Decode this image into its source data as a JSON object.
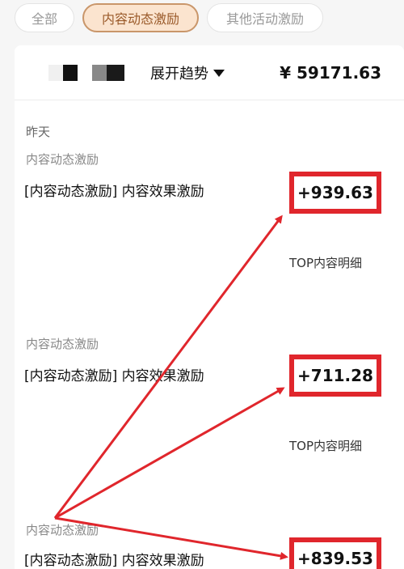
{
  "tabs": {
    "all": "全部",
    "content": "内容动态激励",
    "other": "其他活动激励"
  },
  "summary": {
    "expand_label": "展开趋势",
    "total": "¥ 59171.63"
  },
  "date_label": "昨天",
  "entries": [
    {
      "category": "内容动态激励",
      "description": "[内容动态激励] 内容效果激励",
      "amount": "+939.63",
      "detail_link": "TOP内容明细"
    },
    {
      "category": "内容动态激励",
      "description": "[内容动态激励] 内容效果激励",
      "amount": "+711.28",
      "detail_link": "TOP内容明细"
    },
    {
      "category": "内容动态激励",
      "description": "[内容动态激励] 内容效果激励",
      "amount": "+839.53"
    }
  ],
  "colors": {
    "accent_border": "#c9966a",
    "accent_bg": "#fbe4cf",
    "highlight_red": "#e0262c"
  },
  "icons": [
    "caret-down-icon"
  ]
}
